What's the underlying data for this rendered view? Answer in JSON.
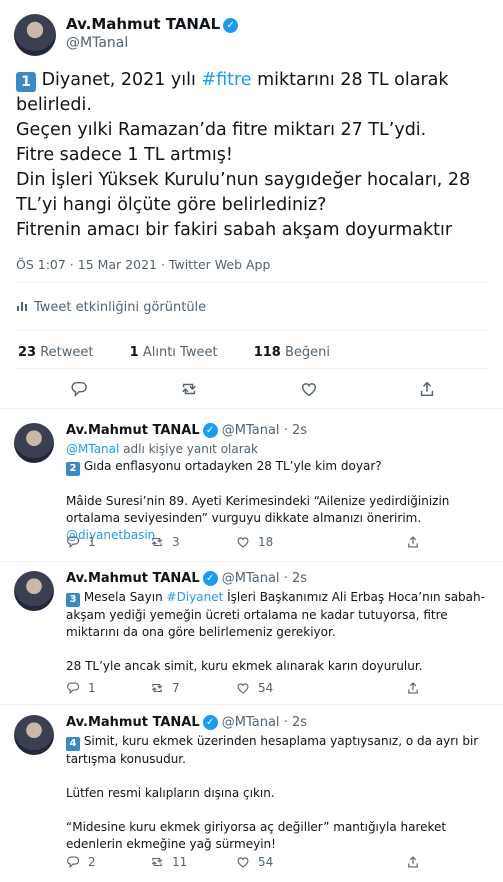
{
  "main_tweet": {
    "author_name": "Av.Mahmut TANAL",
    "handle": "@MTanal",
    "keycap": "1",
    "line1_pre": " Diyanet, 2021 yılı ",
    "line1_hashtag": "#fitre",
    "line1_post": " miktarını 28 TL olarak belirledi.",
    "line2": "Geçen yılki Ramazan’da fitre miktarı 27 TL’ydi.",
    "line3": "Fitre sadece 1 TL artmış!",
    "line4": "Din İşleri Yüksek Kurulu’nun saygıdeğer hocaları, 28 TL’yi hangi ölçüte göre belirlediniz?",
    "line5": "Fitrenin amacı bir fakiri sabah akşam doyurmaktır",
    "meta": "ÖS 1:07 · 15 Mar 2021 · Twitter Web App",
    "activity_label": "Tweet etkinliğini görüntüle",
    "retweets_count": "23",
    "retweets_label": "Retweet",
    "quotes_count": "1",
    "quotes_label": "Alıntı Tweet",
    "likes_count": "118",
    "likes_label": "Beğeni"
  },
  "replies": [
    {
      "name": "Av.Mahmut TANAL",
      "handle": "@MTanal",
      "time": "· 2s",
      "replying_to_handle": "@MTanal",
      "replying_to_suffix": " adlı kişiye yanıt olarak",
      "keycap": "2",
      "p1": " Gıda enflasyonu ortadayken 28 TL’yle kim doyar?",
      "p2": "Mâide Suresi’nin 89. Ayeti Kerimesindeki “Ailenize yedirdiğinizin ortalama seviyesinden” vurguyu dikkate almanızı öneririm.",
      "p2_mention": "@diyanetbasin",
      "replies_count": "1",
      "retweets_count": "3",
      "likes_count": "18"
    },
    {
      "name": "Av.Mahmut TANAL",
      "handle": "@MTanal",
      "time": "· 2s",
      "keycap": "3",
      "p1_pre": " Mesela Sayın ",
      "p1_hashtag": "#Diyanet",
      "p1_post": " İşleri Başkanımız Ali Erbaş Hoca’nın sabah-akşam yediği yemeğin ücreti ortalama ne kadar tutuyorsa, fitre miktarını da ona göre belirlemeniz gerekiyor.",
      "p2": "28 TL’yle ancak simit, kuru ekmek alınarak karın doyurulur.",
      "replies_count": "1",
      "retweets_count": "7",
      "likes_count": "54"
    },
    {
      "name": "Av.Mahmut TANAL",
      "handle": "@MTanal",
      "time": "· 2s",
      "keycap": "4",
      "p1": " Simit, kuru ekmek üzerinden hesaplama yaptıysanız, o da ayrı bir tartışma konusudur.",
      "p2": "Lütfen resmi kalıpların dışına çıkın.",
      "p3": "“Midesine kuru ekmek giriyorsa aç değiller” mantığıyla hareket edenlerin ekmeğine yağ sürmeyin!",
      "replies_count": "2",
      "retweets_count": "11",
      "likes_count": "54"
    }
  ]
}
